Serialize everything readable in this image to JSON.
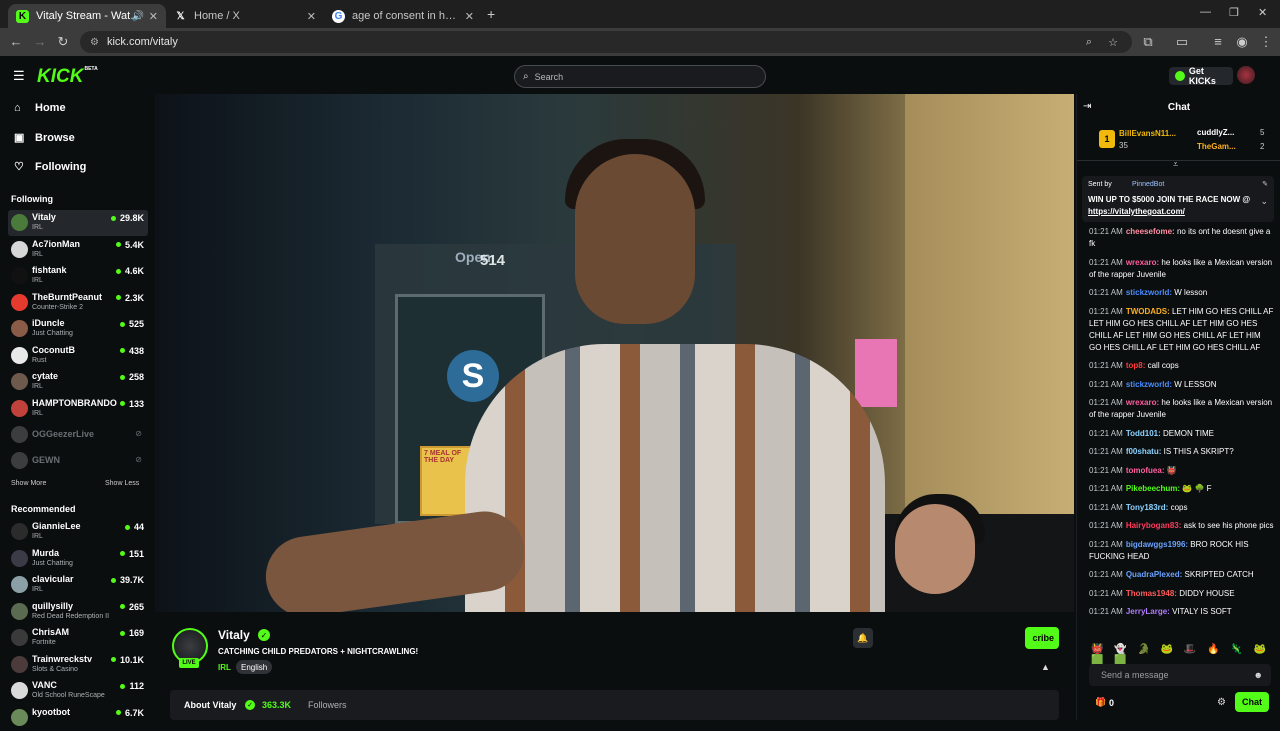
{
  "browser": {
    "tabs": [
      {
        "title": "Vitaly Stream - Watch Live on",
        "icon": "kick-favicon",
        "active": true
      },
      {
        "title": "Home / X",
        "icon": "x-favicon",
        "active": false
      },
      {
        "title": "age of consent in hawaii - Goog",
        "icon": "google-favicon",
        "active": false
      }
    ],
    "url": "kick.com/vitaly"
  },
  "header": {
    "logo": "KICK",
    "logo_badge": "BETA",
    "search_placeholder": "Search",
    "get_kicks_label": "Get KICKs"
  },
  "sidebar": {
    "nav": [
      {
        "label": "Home",
        "icon": "home-icon"
      },
      {
        "label": "Browse",
        "icon": "browse-icon"
      },
      {
        "label": "Following",
        "icon": "heart-icon"
      }
    ],
    "following_heading": "Following",
    "following": [
      {
        "name": "Vitaly",
        "category": "IRL",
        "viewers": "29.8K",
        "color": "#4a7b3a"
      },
      {
        "name": "Ac7ionMan",
        "category": "IRL",
        "viewers": "5.4K",
        "color": "#d6d6d6"
      },
      {
        "name": "fishtank",
        "category": "IRL",
        "viewers": "4.6K",
        "color": "#111111"
      },
      {
        "name": "TheBurntPeanut",
        "category": "Counter-Strike 2",
        "viewers": "2.3K",
        "color": "#e53b2e"
      },
      {
        "name": "iDuncle",
        "category": "Just Chatting",
        "viewers": "525",
        "color": "#8a5b46"
      },
      {
        "name": "CoconutB",
        "category": "Rust",
        "viewers": "438",
        "color": "#e8e8e8"
      },
      {
        "name": "cytate",
        "category": "IRL",
        "viewers": "258",
        "color": "#6e5a4c"
      },
      {
        "name": "HAMPTONBRANDO",
        "category": "IRL",
        "viewers": "133",
        "color": "#c1423a"
      }
    ],
    "offline": [
      {
        "name": "OGGeezerLive"
      },
      {
        "name": "GEWN"
      }
    ],
    "show_more": "Show More",
    "show_less": "Show Less",
    "recommended_heading": "Recommended",
    "recommended": [
      {
        "name": "GiannieLee",
        "category": "IRL",
        "viewers": "44",
        "color": "#2b2b2b"
      },
      {
        "name": "Murda",
        "category": "Just Chatting",
        "viewers": "151",
        "color": "#3b3b48"
      },
      {
        "name": "clavicular",
        "category": "IRL",
        "viewers": "39.7K",
        "color": "#8aa0a6"
      },
      {
        "name": "quillysilly",
        "category": "Red Dead Redemption II",
        "viewers": "265",
        "color": "#5b6b52"
      },
      {
        "name": "ChrisAM",
        "category": "Fortnite",
        "viewers": "169",
        "color": "#3a3a3a"
      },
      {
        "name": "Trainwreckstv",
        "category": "Slots & Casino",
        "viewers": "10.1K",
        "color": "#4b3b3b"
      },
      {
        "name": "VANC",
        "category": "Old School RuneScape",
        "viewers": "112",
        "color": "#d9d9d9"
      },
      {
        "name": "kyootbot",
        "category": "",
        "viewers": "6.7K",
        "color": "#6a8a5a"
      }
    ]
  },
  "stream": {
    "channel": "Vitaly",
    "live_badge": "LIVE",
    "title": "CATCHING CHILD PREDATORS + NIGHTCRAWLING!",
    "category": "IRL",
    "language": "English",
    "subscribe_label": "cribe",
    "about_label": "About Vitaly",
    "followers_count": "363.3K",
    "followers_label": "Followers",
    "video_sign_number": "514",
    "video_store_word": "Open",
    "video_meal_text": "7 MEAL OF THE DAY"
  },
  "chat": {
    "title": "Chat",
    "gifters": [
      {
        "name": "BillEvansN11...",
        "count": "35",
        "rank": "1"
      },
      {
        "name": "cuddlyZ...",
        "count": "5"
      },
      {
        "name": "TheGam...",
        "count": "2"
      }
    ],
    "pinned": {
      "sent_by": "Sent by",
      "bot": "PinnedBot",
      "message": "WIN UP TO $5000 JOIN THE RACE NOW @",
      "link": "https://vitalythegoat.com/"
    },
    "messages": [
      {
        "time": "01:21 AM",
        "user": "cheesefome:",
        "color": "#ff8fa3",
        "text": "no its ont he doesnt give a fk"
      },
      {
        "time": "01:21 AM",
        "user": "wrexaro:",
        "color": "#ff5ea0",
        "text": "he looks like a Mexican version of the rapper Juvenile"
      },
      {
        "time": "01:21 AM",
        "user": "stickzworld:",
        "color": "#4a8cff",
        "text": "W lesson"
      },
      {
        "time": "01:21 AM",
        "user": "TWODADS:",
        "color": "#ffb020",
        "text": "LET HIM GO HES CHILL AF LET HIM GO HES CHILL AF LET HIM GO HES CHILL AF LET HIM GO HES CHILL AF LET HIM GO HES CHILL AF LET HIM GO HES CHILL AF"
      },
      {
        "time": "01:21 AM",
        "user": "top8:",
        "color": "#ff3b3b",
        "text": "call cops"
      },
      {
        "time": "01:21 AM",
        "user": "stickzworld:",
        "color": "#4a8cff",
        "text": "W LESSON"
      },
      {
        "time": "01:21 AM",
        "user": "wrexaro:",
        "color": "#ff5ea0",
        "text": "he looks like a Mexican version of the rapper Juvenile"
      },
      {
        "time": "01:21 AM",
        "user": "Todd101:",
        "color": "#8bd3ff",
        "text": "DEMON TIME"
      },
      {
        "time": "01:21 AM",
        "user": "f00shatu:",
        "color": "#8bd3ff",
        "text": "IS THIS A SKRIPT?"
      },
      {
        "time": "01:21 AM",
        "user": "tomofuea:",
        "color": "#ff5ea0",
        "text": "👹"
      },
      {
        "time": "01:21 AM",
        "user": "Pikebeechum:",
        "color": "#53fc18",
        "text": "🐸 🌳 F"
      },
      {
        "time": "01:21 AM",
        "user": "Tony183rd:",
        "color": "#8bd3ff",
        "text": "cops"
      },
      {
        "time": "01:21 AM",
        "user": "Hairybogan83:",
        "color": "#ff3b5c",
        "text": "ask to see his phone pics"
      },
      {
        "time": "01:21 AM",
        "user": "bigdawggs1996:",
        "color": "#6aa2ff",
        "text": "BRO ROCK HIS FUCKING HEAD"
      },
      {
        "time": "01:21 AM",
        "user": "QuadraPlexed:",
        "color": "#6aa2ff",
        "text": "SKRIPTED CATCH"
      },
      {
        "time": "01:21 AM",
        "user": "Thomas1948:",
        "color": "#ff5a5a",
        "text": "DIDDY HOUSE"
      },
      {
        "time": "01:21 AM",
        "user": "JerryLarge:",
        "color": "#b07cff",
        "text": "VITALY IS SOFT"
      }
    ],
    "emote_bar": "👹 👻 🐊 🐸 🎩 🔥 🦎 🐸 🟩 🟩",
    "send_placeholder": "Send a message",
    "kicks_count": "0",
    "chat_button": "Chat"
  }
}
